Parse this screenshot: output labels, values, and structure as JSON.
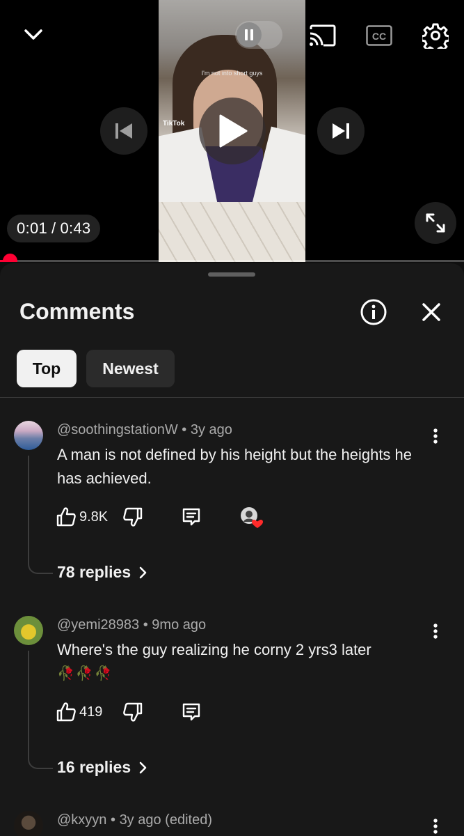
{
  "player": {
    "video_caption": "I'm not into short guys",
    "video_watermark": "TikTok",
    "time_current": "0:01",
    "time_separator": "/",
    "time_total": "0:43",
    "progress_fraction": 0.023,
    "accent_color": "#ff0033",
    "icons": [
      "chevron-down-icon",
      "pause-icon",
      "cast-icon",
      "cc-icon",
      "settings-gear-icon",
      "skip-previous-icon",
      "play-icon",
      "skip-next-icon",
      "fullscreen-icon"
    ],
    "cc_label": "CC"
  },
  "comments_panel": {
    "title": "Comments",
    "filters": [
      {
        "label": "Top",
        "selected": true
      },
      {
        "label": "Newest",
        "selected": false
      }
    ],
    "comments": [
      {
        "author": "@soothingstationW",
        "age": "3y ago",
        "text": "A man is not defined by his height but the heights he has achieved.",
        "likes": "9.8K",
        "creator_hearted": true,
        "replies": "78 replies"
      },
      {
        "author": "@yemi28983",
        "age": "9mo ago",
        "text": "Where's the guy realizing he corny 2 yrs3 later",
        "emoji": "🥀🥀🥀",
        "likes": "419",
        "creator_hearted": false,
        "replies": "16 replies"
      },
      {
        "author": "@kxyyn",
        "age": "3y ago (edited)"
      }
    ]
  }
}
